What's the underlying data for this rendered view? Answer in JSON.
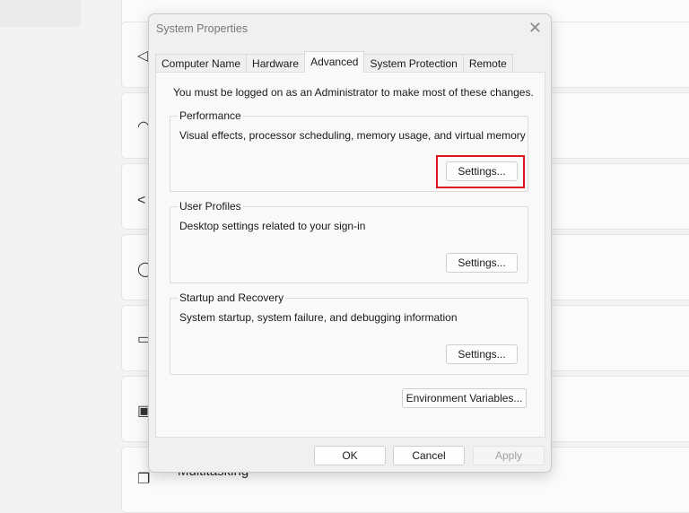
{
  "background": {
    "bottom_item": "Multitasking"
  },
  "dialog": {
    "title": "System Properties",
    "tabs": [
      {
        "label": "Computer Name"
      },
      {
        "label": "Hardware"
      },
      {
        "label": "Advanced",
        "active": true
      },
      {
        "label": "System Protection"
      },
      {
        "label": "Remote"
      }
    ],
    "note": "You must be logged on as an Administrator to make most of these changes.",
    "groups": {
      "performance": {
        "label": "Performance",
        "desc": "Visual effects, processor scheduling, memory usage, and virtual memory",
        "button": "Settings..."
      },
      "user_profiles": {
        "label": "User Profiles",
        "desc": "Desktop settings related to your sign-in",
        "button": "Settings..."
      },
      "startup": {
        "label": "Startup and Recovery",
        "desc": "System startup, system failure, and debugging information",
        "button": "Settings..."
      }
    },
    "env_button": "Environment Variables...",
    "ok": "OK",
    "cancel": "Cancel",
    "apply": "Apply",
    "highlight_color": "#e0141e"
  }
}
